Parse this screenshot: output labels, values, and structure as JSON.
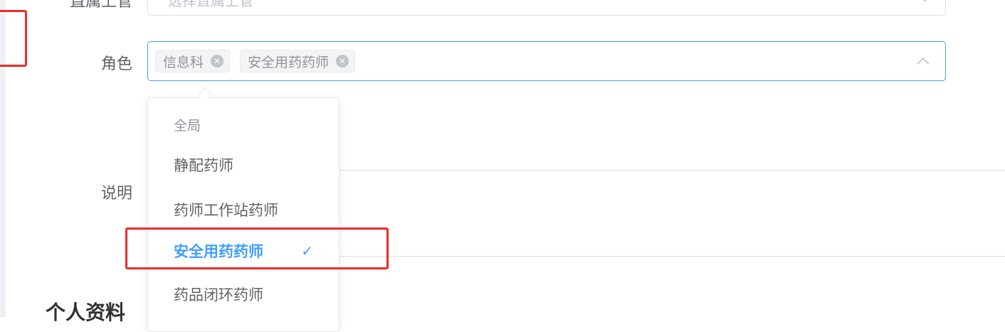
{
  "form": {
    "supervisor": {
      "label": "直属上管",
      "placeholder": "选择直属上管"
    },
    "role": {
      "label": "角色",
      "selected_tags": [
        "信息科",
        "安全用药药师"
      ]
    },
    "description": {
      "label": "说明"
    }
  },
  "dropdown": {
    "group_title": "全局",
    "options": [
      {
        "label": "静配药师",
        "selected": false
      },
      {
        "label": "药师工作站药师",
        "selected": false
      },
      {
        "label": "安全用药药师",
        "selected": true
      },
      {
        "label": "药品闭环药师",
        "selected": false
      }
    ]
  },
  "section": {
    "title": "个人资料"
  },
  "colors": {
    "accent": "#409eff",
    "annotation": "#ee2b2b",
    "tag_bg": "#f4f4f5"
  },
  "icons": {
    "tag_close": "circle-x-icon",
    "select_arrow": "chevron-up-icon",
    "check": "check-icon"
  }
}
